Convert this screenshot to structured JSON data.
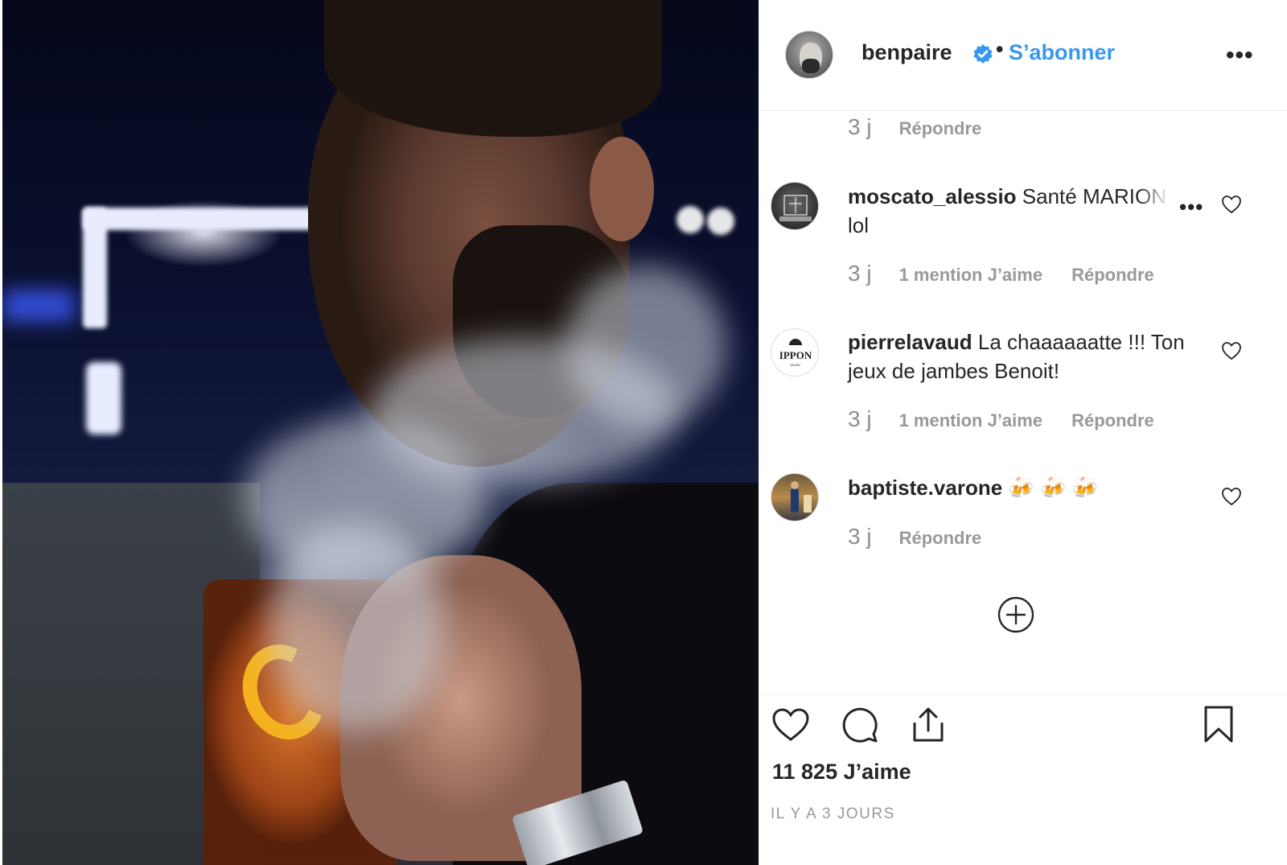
{
  "post": {
    "author": "benpaire",
    "follow_label": "S’abonner",
    "separator": "•",
    "more_glyph": "•••",
    "likes": "11 825 J’aime",
    "time_ago": "IL Y A 3 JOURS"
  },
  "comments": [
    {
      "time": "3 j",
      "reply_label": "Répondre"
    },
    {
      "username": "moscato_alessio",
      "text": "Santé MARION lol",
      "time": "3 j",
      "likes": "1 mention J’aime",
      "reply_label": "Répondre",
      "more_glyph": "•••"
    },
    {
      "username": "pierrelavaud",
      "text": "La chaaaaaatte !!! Ton jeux de jambes Benoit!",
      "time": "3 j",
      "likes": "1 mention J’aime",
      "reply_label": "Répondre",
      "avatar_text": "IPPON"
    },
    {
      "username": "baptiste.varone",
      "text": "🍻 🍻 🍻",
      "time": "3 j",
      "reply_label": "Répondre"
    }
  ],
  "icons": {
    "verified": "verified-badge-icon",
    "like": "heart-icon",
    "comment": "comment-icon",
    "share": "share-icon",
    "save": "bookmark-icon",
    "load_more": "plus-circle-icon"
  },
  "colors": {
    "link": "#3897f0",
    "text": "#262626",
    "muted": "#999999",
    "divider": "#efefef"
  }
}
